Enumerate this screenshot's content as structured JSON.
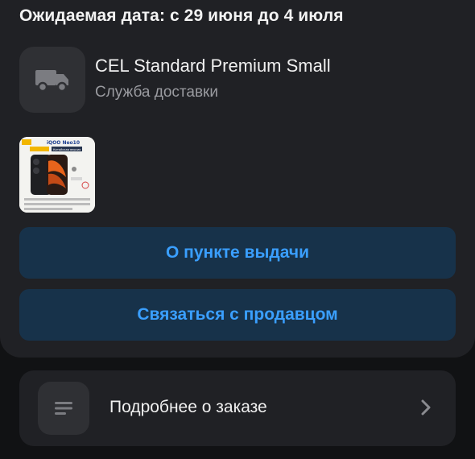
{
  "order": {
    "expected_date": "Ожидаемая дата: с 29 июня до 4 июля"
  },
  "delivery": {
    "icon": "truck-icon",
    "service_name": "CEL Standard Premium Small",
    "service_label": "Служба доставки"
  },
  "product": {
    "thumb_title": "iQOO Neo10",
    "thumb_badge": "Китайская версия"
  },
  "actions": {
    "pickup_label": "О пункте выдачи",
    "contact_seller_label": "Связаться с продавцом"
  },
  "details": {
    "icon": "list-icon",
    "label": "Подробнее о заказе",
    "chevron": "chevron-right-icon"
  },
  "colors": {
    "background": "#111214",
    "card": "#202125",
    "icon_tile": "#2f3034",
    "button_bg": "#17324a",
    "accent": "#3a9fff",
    "secondary_text": "#9a9ba0"
  }
}
